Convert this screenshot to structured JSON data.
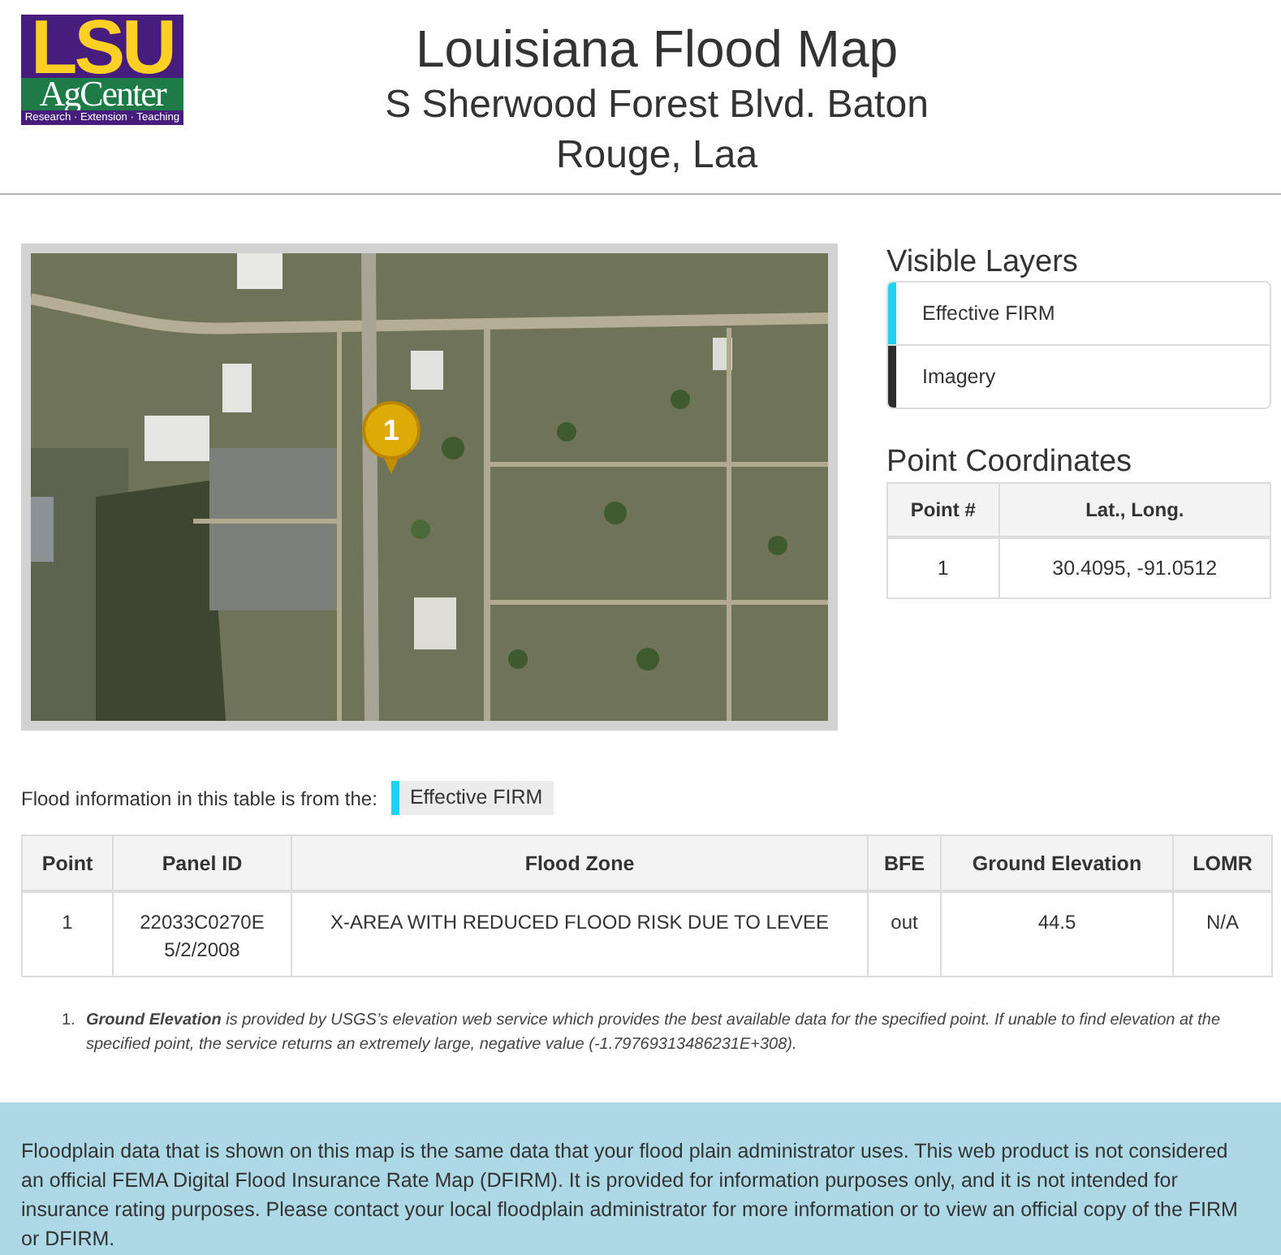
{
  "header": {
    "logo": {
      "top": "LSU",
      "middle": "AgCenter",
      "bottom": "Research · Extension · Teaching"
    },
    "title": "Louisiana Flood Map",
    "subtitle": "S Sherwood Forest Blvd. Baton Rouge, Laa"
  },
  "map": {
    "marker": {
      "label": "1"
    }
  },
  "visible_layers": {
    "title": "Visible Layers",
    "items": [
      {
        "label": "Effective FIRM",
        "color": "#1ed3f0"
      },
      {
        "label": "Imagery",
        "color": "#2d2d2d"
      }
    ]
  },
  "point_coordinates": {
    "title": "Point Coordinates",
    "columns": [
      "Point #",
      "Lat., Long."
    ],
    "rows": [
      [
        "1",
        "30.4095, -91.0512"
      ]
    ]
  },
  "flood_source": {
    "label": "Flood information in this table is from the:",
    "tag": "Effective FIRM"
  },
  "flood_table": {
    "columns": [
      "Point",
      "Panel ID",
      "Flood Zone",
      "BFE",
      "Ground Elevation",
      "LOMR"
    ],
    "rows": [
      {
        "point": "1",
        "panel": {
          "id": "22033C0270E",
          "date": "5/2/2008"
        },
        "flood_zone": "X-AREA WITH REDUCED FLOOD RISK DUE TO LEVEE",
        "bfe": "out",
        "ground_elevation": "44.5",
        "lomr": "N/A"
      }
    ]
  },
  "footnotes": [
    {
      "number": "1.",
      "text": "**Ground Elevation** is provided by USGS’s elevation web service which provides the best available data for the specified point. If unable to find elevation at the specified point, the service returns an extremely large, negative value (-1.79769313486231E+308)."
    }
  ],
  "disclaimer": "Floodplain data that is shown on this map is the same data that your flood plain administrator uses. This web product is not considered an official FEMA Digital Flood Insurance Rate Map (DFIRM). It is provided for information purposes only, and it is not intended for insurance rating purposes. Please contact your local floodplain administrator for more information or to view an official copy of the FIRM or DFIRM."
}
